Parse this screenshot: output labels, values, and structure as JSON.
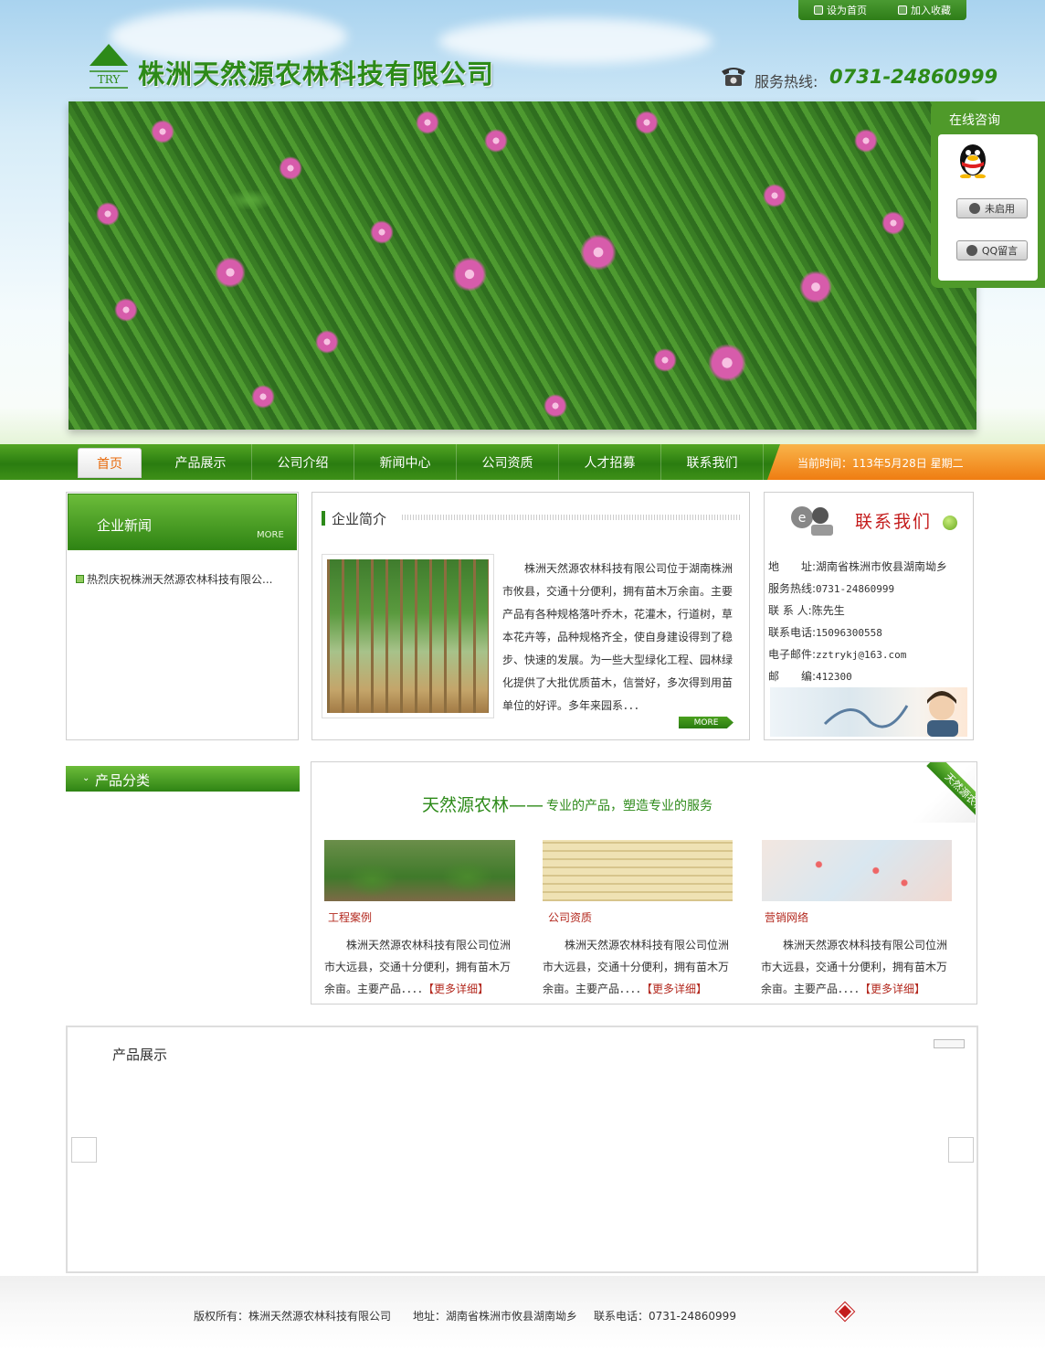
{
  "topbar": {
    "set_home": "设为首页",
    "add_fav": "加入收藏"
  },
  "header": {
    "logo_text": "TRY",
    "company_name": "株洲天然源农林科技有限公司",
    "hotline_label": "服务热线:",
    "hotline_number": "0731-24860999"
  },
  "qq": {
    "title": "在线咨询",
    "status_label": "未启用",
    "message_label": "QQ留言"
  },
  "nav": {
    "items": [
      "首页",
      "产品展示",
      "公司介绍",
      "新闻中心",
      "公司资质",
      "人才招募",
      "联系我们"
    ],
    "active_index": 0,
    "time_text": "当前时间：113年5月28日 星期二"
  },
  "news": {
    "title": "企业新闻",
    "more": "MORE",
    "items": [
      "热烈庆祝株洲天然源农林科技有限公..."
    ]
  },
  "intro": {
    "title": "企业简介",
    "text": "株洲天然源农林科技有限公司位于湖南株洲市攸县，交通十分便利，拥有苗木万余亩。主要产品有各种规格落叶乔木，花灌木，行道树，草本花卉等，品种规格齐全，使自身建设得到了稳步、快速的发展。为一些大型绿化工程、园林绿化提供了大批优质苗木，信誉好，多次得到用苗单位的好评。多年来园系．．．",
    "more": "MORE"
  },
  "contact": {
    "title": "联系我们",
    "rows": [
      {
        "label": "地　　址:",
        "value": "湖南省株洲市攸县湖南坳乡"
      },
      {
        "label": "服务热线:",
        "value": "0731-24860999"
      },
      {
        "label": "联 系 人:",
        "value": "陈先生"
      },
      {
        "label": "联系电话:",
        "value": "15096300558"
      },
      {
        "label": "电子邮件:",
        "value": "zztrykj@163.com"
      },
      {
        "label": "邮　　编:",
        "value": "412300"
      }
    ]
  },
  "category": {
    "title": "产品分类"
  },
  "slogan": {
    "main": "天然源农林——",
    "sub": "专业的产品，塑造专业的服务",
    "ribbon": "天然源农林"
  },
  "features": [
    {
      "label": "工程案例",
      "text": "株洲天然源农林科技有限公司位洲市大远县，交通十分便利，拥有苗木万余亩。主要产品．．．．",
      "detail": "【更多详细】"
    },
    {
      "label": "公司资质",
      "text": "株洲天然源农林科技有限公司位洲市大远县，交通十分便利，拥有苗木万余亩。主要产品．．．．",
      "detail": "【更多详细】"
    },
    {
      "label": "营销网络",
      "text": "株洲天然源农林科技有限公司位洲市大远县，交通十分便利，拥有苗木万余亩。主要产品．．．．",
      "detail": "【更多详细】"
    }
  ],
  "showcase": {
    "title": "产品展示"
  },
  "footer": {
    "copyright": "版权所有：株洲天然源农林科技有限公司",
    "address": "地址：湖南省株洲市攸县湖南坳乡",
    "phone": "联系电话：0731-24860999"
  },
  "colors": {
    "brand_green": "#2d8a19",
    "accent_orange": "#ef7d12",
    "highlight_red": "#c41c1c"
  }
}
